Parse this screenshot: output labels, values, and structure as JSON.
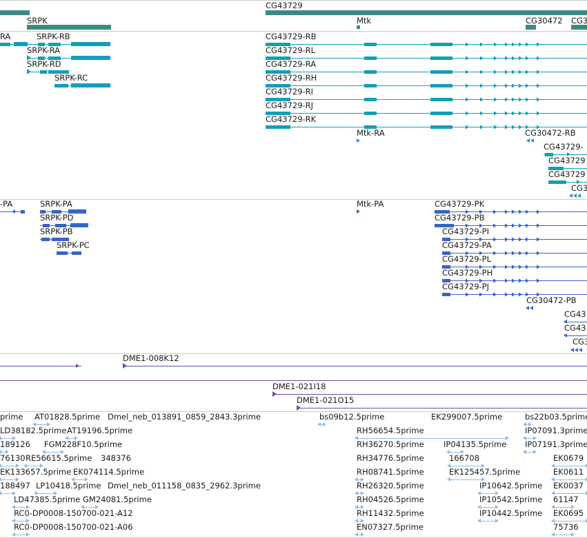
{
  "genes": {
    "labels": [
      "CG43729",
      "SRPK",
      "Mtk",
      "CG30472",
      "CG3"
    ],
    "color": "#3a8a84"
  },
  "mrna": {
    "labels": [
      "RA",
      "SRPK-RB",
      "SRPK-RA",
      "SRPK-RD",
      "SRPK-RC",
      "CG43729-RB",
      "CG43729-RL",
      "CG43729-RA",
      "CG43729-RH",
      "CG43729-RI",
      "CG43729-RJ",
      "CG43729-RK",
      "Mtk-RA",
      "CG30472-RB",
      "CG43729-",
      "CG43729",
      "CG43729",
      "CG3"
    ],
    "color": "#119fbb"
  },
  "proteins": {
    "labels": [
      "-PA",
      "SRPK-PA",
      "SRPK-PD",
      "SRPK-PB",
      "SRPK-PC",
      "Mtk-PA",
      "CG43729-PK",
      "CG43729-PB",
      "CG43729-PI",
      "CG43729-PA",
      "CG43729-PL",
      "CG43729-PH",
      "CG43729-PJ",
      "CG30472-PB",
      "CG43",
      "CG43",
      "CG3"
    ],
    "color": "#3565c8"
  },
  "clones": {
    "labels": [
      "DME1-008K12",
      "DME1-021I18",
      "DME1-021O15"
    ],
    "color": "#7249a8"
  },
  "ests": {
    "labels": [
      "prime",
      "AT01828.5prime",
      "Dmel_neb_013891_0859_2843.3prime",
      "bs09b12.5prime",
      "EK299007.5prime",
      "bs22b03.5prime",
      "LD38182.5prime",
      "AT19196.5prime",
      "RH56654.5prime",
      "IP07091.3prime",
      "189126",
      "FGM228F10.5prime",
      "RH36270.5prime",
      "IP04135.5prime",
      "IP07191.3prime",
      "76130",
      "RE56615.5prime",
      "348376",
      "RH34776.5prime",
      "166708",
      "EK0679",
      "EK133657.5prime",
      "EK074114.5prime",
      "RH08741.5prime",
      "EK125457.5prime",
      "EK0611",
      "188497",
      "LP10418.5prime",
      "Dmel_neb_011158_0835_2962.3prime",
      "RH26320.5prime",
      "IP10642.5prime",
      "EK0037",
      "LD47385.5prime",
      "GM24081.5prime",
      "RH04526.5prime",
      "IP10542.5prime",
      "61147",
      "RC0-DP0008-150700-021-A12",
      "RH11432.5prime",
      "IP10442.5prime",
      "EK0695",
      "RC0-DP0008-150700-021-A06",
      "EN07327.5prime",
      "75736"
    ],
    "color": "#8cbde6"
  }
}
